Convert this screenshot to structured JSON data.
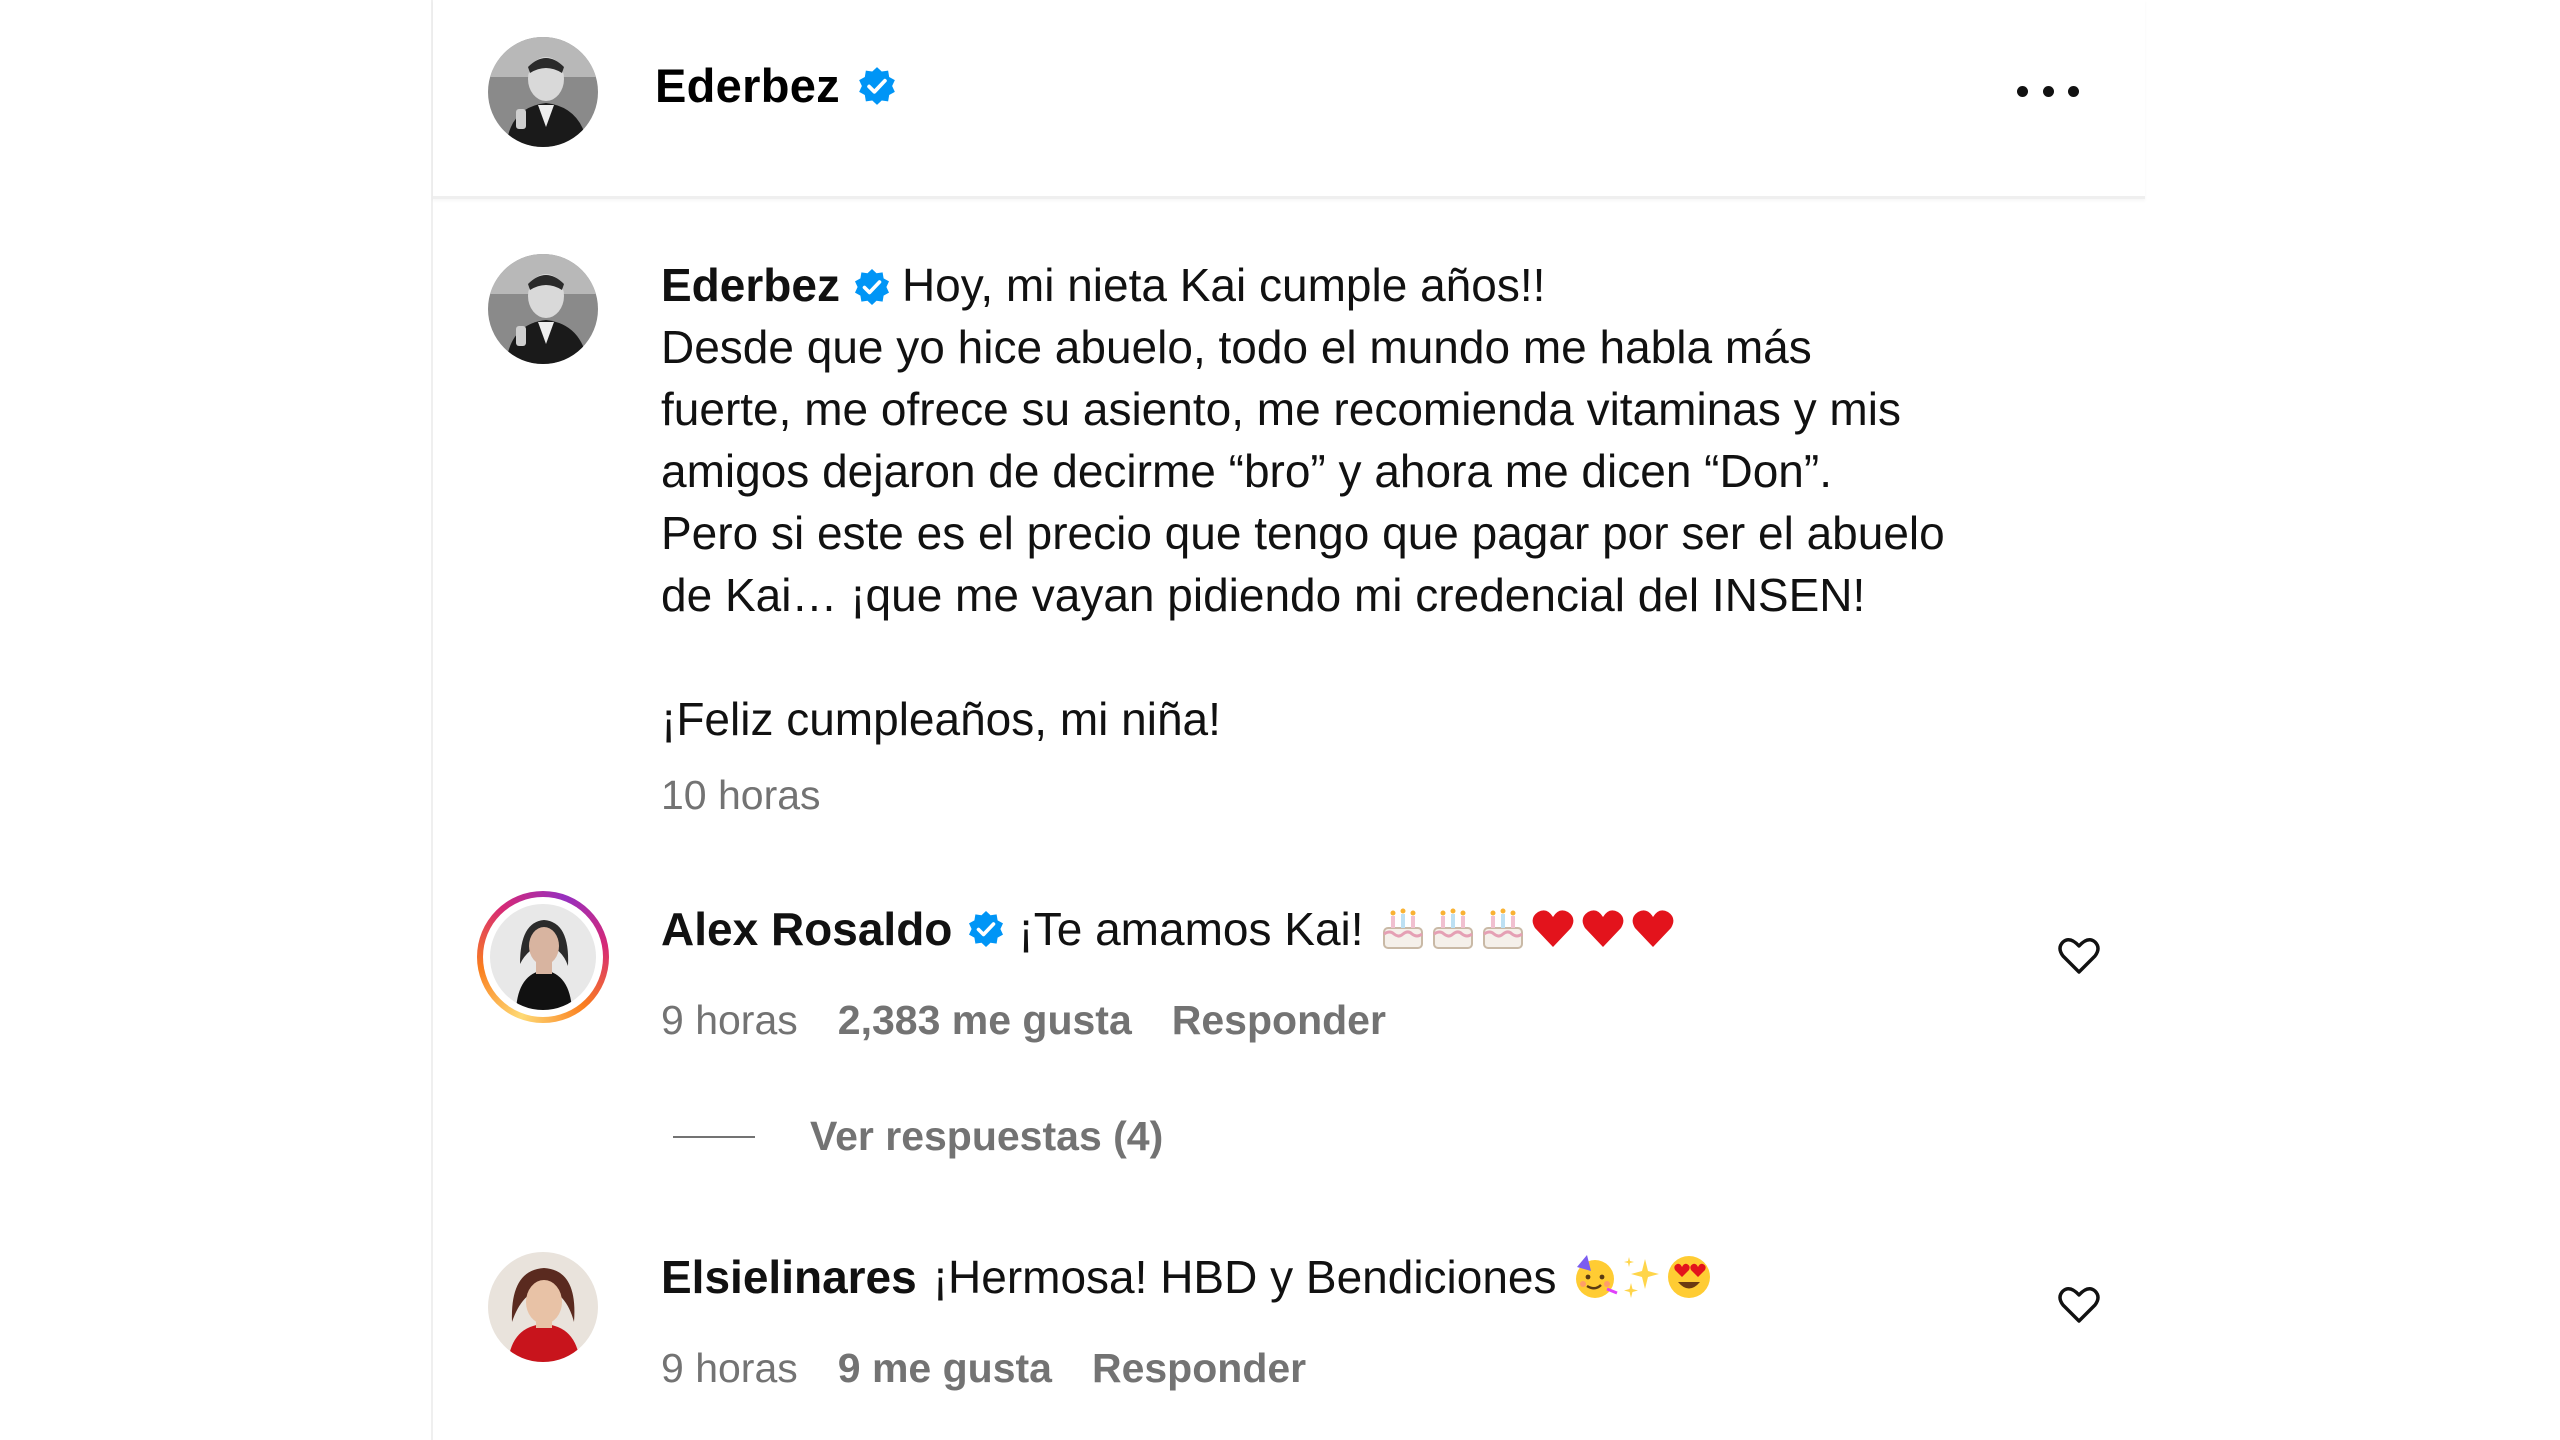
{
  "header": {
    "username": "Ederbez",
    "verified": true,
    "more_icon": "more-horizontal-icon"
  },
  "caption": {
    "username": "Ederbez",
    "lines": [
      "Hoy, mi nieta Kai cumple años!!",
      "Desde que yo hice abuelo, todo el mundo me habla más",
      "fuerte, me ofrece su asiento, me recomienda vitaminas y mis",
      "amigos dejaron de decirme “bro” y ahora me dicen “Don”.",
      "Pero si este es el precio que tengo que pagar por ser el abuelo",
      "de Kai… ¡que me vayan pidiendo mi credencial del INSEN!",
      "",
      "¡Feliz cumpleaños, mi niña!"
    ],
    "time": "10 horas"
  },
  "comments": [
    {
      "username": "Alex Rosaldo",
      "verified": true,
      "text": "¡Te amamos Kai!",
      "emojis": [
        "cake",
        "cake",
        "cake",
        "heart",
        "heart",
        "heart"
      ],
      "time": "9 horas",
      "likes": "2,383 me gusta",
      "reply": "Responder",
      "view_replies": "Ver respuestas (4)"
    },
    {
      "username": "Elsielinares",
      "verified": false,
      "text": "¡Hermosa! HBD y Bendiciones",
      "emojis": [
        "partying-face",
        "sparkles",
        "heart-eyes"
      ],
      "time": "9 horas",
      "likes": "9 me gusta",
      "reply": "Responder"
    }
  ],
  "colors": {
    "verified_blue": "#0095f6",
    "muted_text": "#737373",
    "divider": "#efefef",
    "heart_red": "#e3131c"
  }
}
